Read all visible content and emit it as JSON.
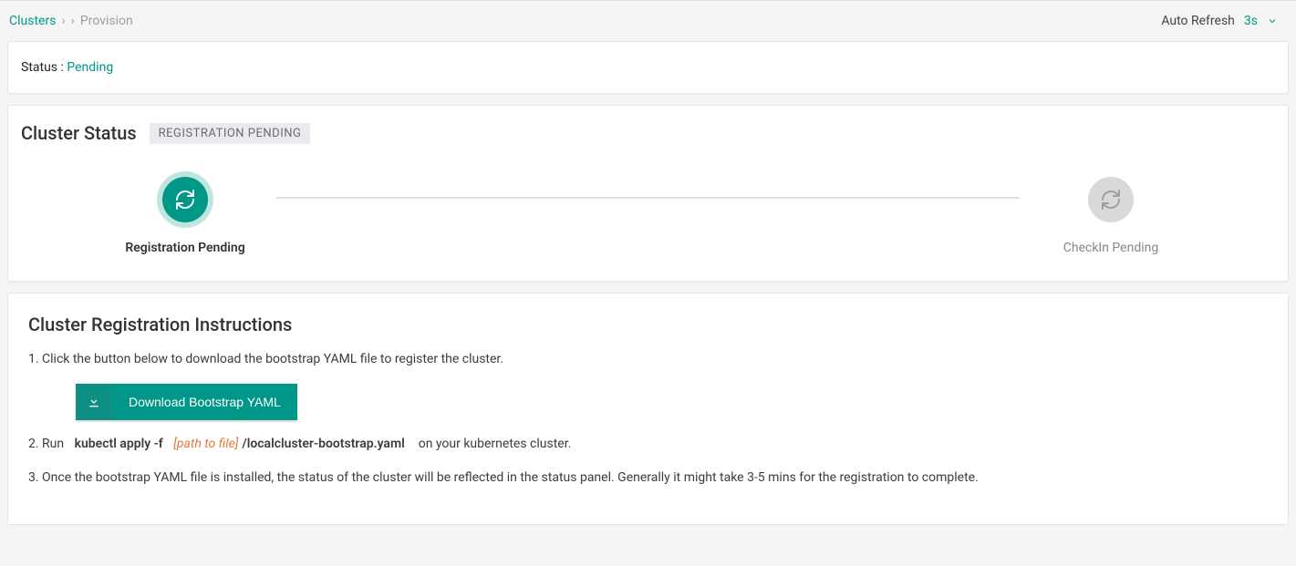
{
  "breadcrumb": {
    "root": "Clusters",
    "current": "Provision"
  },
  "autoRefresh": {
    "label": "Auto Refresh",
    "interval": "3s"
  },
  "statusBar": {
    "label": "Status :",
    "value": "Pending"
  },
  "clusterStatus": {
    "title": "Cluster Status",
    "badge": "REGISTRATION PENDING",
    "steps": {
      "registration": "Registration Pending",
      "checkin": "CheckIn Pending"
    }
  },
  "instructions": {
    "title": "Cluster Registration Instructions",
    "step1": "1. Click the button below to download the bootstrap YAML file to register the cluster.",
    "downloadLabel": "Download Bootstrap YAML",
    "step2_prefix": "2. Run",
    "step2_cmd": "kubectl apply -f",
    "step2_path": "[path to file]",
    "step2_file": "/localcluster-bootstrap.yaml",
    "step2_suffix": "on your kubernetes cluster.",
    "step3": "3. Once the bootstrap YAML file is installed, the status of the cluster will be reflected in the status panel. Generally it might take 3-5 mins for the registration to complete."
  }
}
